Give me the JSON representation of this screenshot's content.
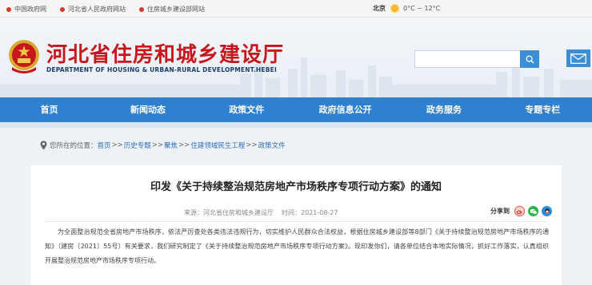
{
  "topbar": {
    "links": [
      "中国政府网",
      "河北省人民政府网站",
      "住房城乡建设部网站"
    ],
    "weather_city": "北京",
    "weather_temp": "0°C ~ 12°C"
  },
  "header": {
    "title": "河北省住房和城乡建设厅",
    "subtitle": "DEPARTMENT OF HOUSING & URBAN-RURAL DEVELOPMENT.HEBEI",
    "search_value": ""
  },
  "nav": {
    "items": [
      "首页",
      "新闻动态",
      "政策文件",
      "政府信息公开",
      "政务服务",
      "专题专栏"
    ]
  },
  "breadcrumb": {
    "prefix": "您所在的位置：",
    "items": [
      "首页",
      "历史专题",
      "聚焦",
      "住建领域民生工程",
      "政策文件"
    ],
    "separator": ">>"
  },
  "article": {
    "title": "印发《关于持续整治规范房地产市场秩序专项行动方案》的通知",
    "source": "来源：河北省住房和城乡建设厅",
    "time": "时间：2021-08-27",
    "share_label": "分享到",
    "body": "为全面整治规范全省房地产市场秩序，依法严厉查处各类违法违规行为，切实维护人民群众合法权益，根据住房城乡建设部等8部门《关于持续整治规范房地产市场秩序的通知》（建房〔2021〕55号）有关要求，我们研究制定了《关于持续整治规范房地产市场秩序专项行动方案》。现印发你们，请各单位结合本地实际情况，抓好工作落实，认真组织开展整治规范房地产市场秩序专项行动。"
  },
  "colors": {
    "brand_red": "#c8161d",
    "nav_blue": "#2f81cf",
    "link_blue": "#2f6fb7"
  },
  "icons": [
    "emblem-icon",
    "search-icon",
    "mail-icon",
    "location-pin-icon",
    "weibo-icon",
    "wechat-icon",
    "qq-icon",
    "sun-icon"
  ]
}
